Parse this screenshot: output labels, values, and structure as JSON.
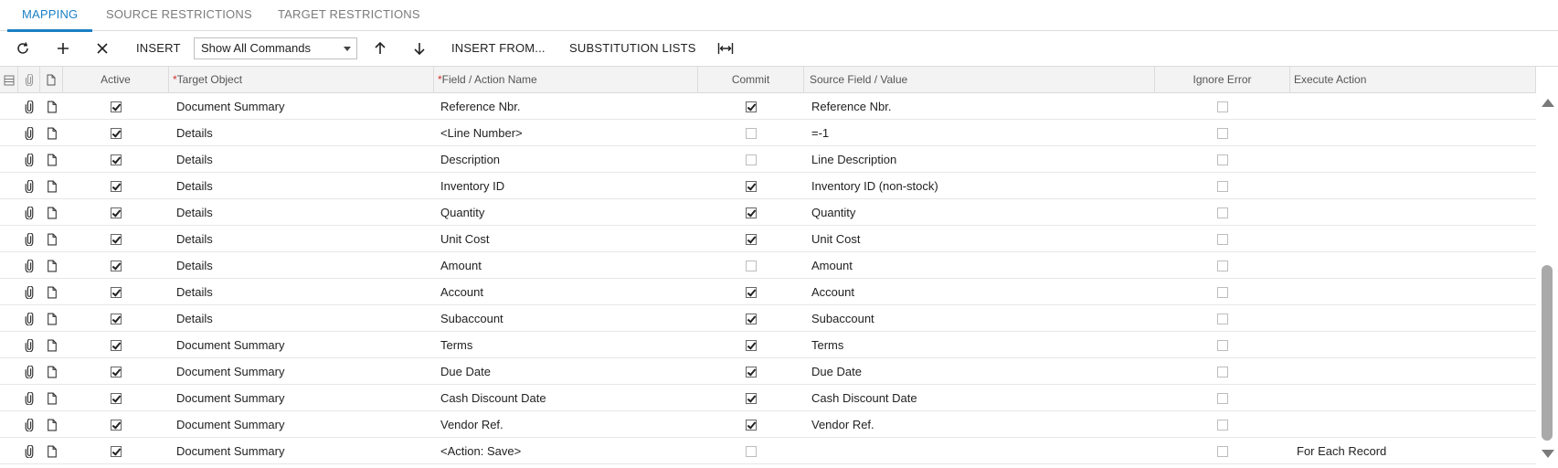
{
  "tabs": [
    {
      "label": "MAPPING",
      "active": true
    },
    {
      "label": "SOURCE RESTRICTIONS",
      "active": false
    },
    {
      "label": "TARGET RESTRICTIONS",
      "active": false
    }
  ],
  "toolbar": {
    "refresh_icon": "refresh-icon",
    "add_icon": "plus-icon",
    "delete_icon": "close-icon",
    "insert_label": "INSERT",
    "commands_select": {
      "value": "Show All Commands",
      "options": [
        "Show All Commands"
      ]
    },
    "move_up_icon": "arrow-up-icon",
    "move_down_icon": "arrow-down-icon",
    "insert_from_label": "INSERT FROM...",
    "substitution_lists_label": "SUBSTITUTION LISTS",
    "fit_columns_icon": "fit-columns-icon"
  },
  "grid": {
    "columns": {
      "active": "Active",
      "target_object": "Target Object",
      "field_action": "Field / Action Name",
      "commit": "Commit",
      "source_field": "Source Field / Value",
      "ignore_error": "Ignore Error",
      "execute_action": "Execute Action"
    },
    "required_marker": "*",
    "rows": [
      {
        "active": true,
        "target": "Document Summary",
        "field": "Reference Nbr.",
        "commit": true,
        "source": "Reference Nbr.",
        "ignore": false,
        "execute": ""
      },
      {
        "active": true,
        "target": "Details",
        "field": "<Line Number>",
        "commit": false,
        "source": "=-1",
        "ignore": false,
        "execute": ""
      },
      {
        "active": true,
        "target": "Details",
        "field": "Description",
        "commit": false,
        "source": "Line Description",
        "ignore": false,
        "execute": ""
      },
      {
        "active": true,
        "target": "Details",
        "field": "Inventory ID",
        "commit": true,
        "source": "Inventory ID (non-stock)",
        "ignore": false,
        "execute": ""
      },
      {
        "active": true,
        "target": "Details",
        "field": "Quantity",
        "commit": true,
        "source": "Quantity",
        "ignore": false,
        "execute": ""
      },
      {
        "active": true,
        "target": "Details",
        "field": "Unit Cost",
        "commit": true,
        "source": "Unit Cost",
        "ignore": false,
        "execute": ""
      },
      {
        "active": true,
        "target": "Details",
        "field": "Amount",
        "commit": false,
        "source": "Amount",
        "ignore": false,
        "execute": ""
      },
      {
        "active": true,
        "target": "Details",
        "field": "Account",
        "commit": true,
        "source": "Account",
        "ignore": false,
        "execute": ""
      },
      {
        "active": true,
        "target": "Details",
        "field": "Subaccount",
        "commit": true,
        "source": "Subaccount",
        "ignore": false,
        "execute": ""
      },
      {
        "active": true,
        "target": "Document Summary",
        "field": "Terms",
        "commit": true,
        "source": "Terms",
        "ignore": false,
        "execute": ""
      },
      {
        "active": true,
        "target": "Document Summary",
        "field": "Due Date",
        "commit": true,
        "source": "Due Date",
        "ignore": false,
        "execute": ""
      },
      {
        "active": true,
        "target": "Document Summary",
        "field": "Cash Discount Date",
        "commit": true,
        "source": "Cash Discount Date",
        "ignore": false,
        "execute": ""
      },
      {
        "active": true,
        "target": "Document Summary",
        "field": "Vendor Ref.",
        "commit": true,
        "source": "Vendor Ref.",
        "ignore": false,
        "execute": ""
      },
      {
        "active": true,
        "target": "Document Summary",
        "field": "<Action: Save>",
        "commit": false,
        "source": "",
        "ignore": false,
        "execute": "For Each Record"
      }
    ]
  },
  "colors": {
    "accent": "#1a7fc4",
    "required": "#d0312d",
    "header_bg": "#f3f3f3"
  }
}
